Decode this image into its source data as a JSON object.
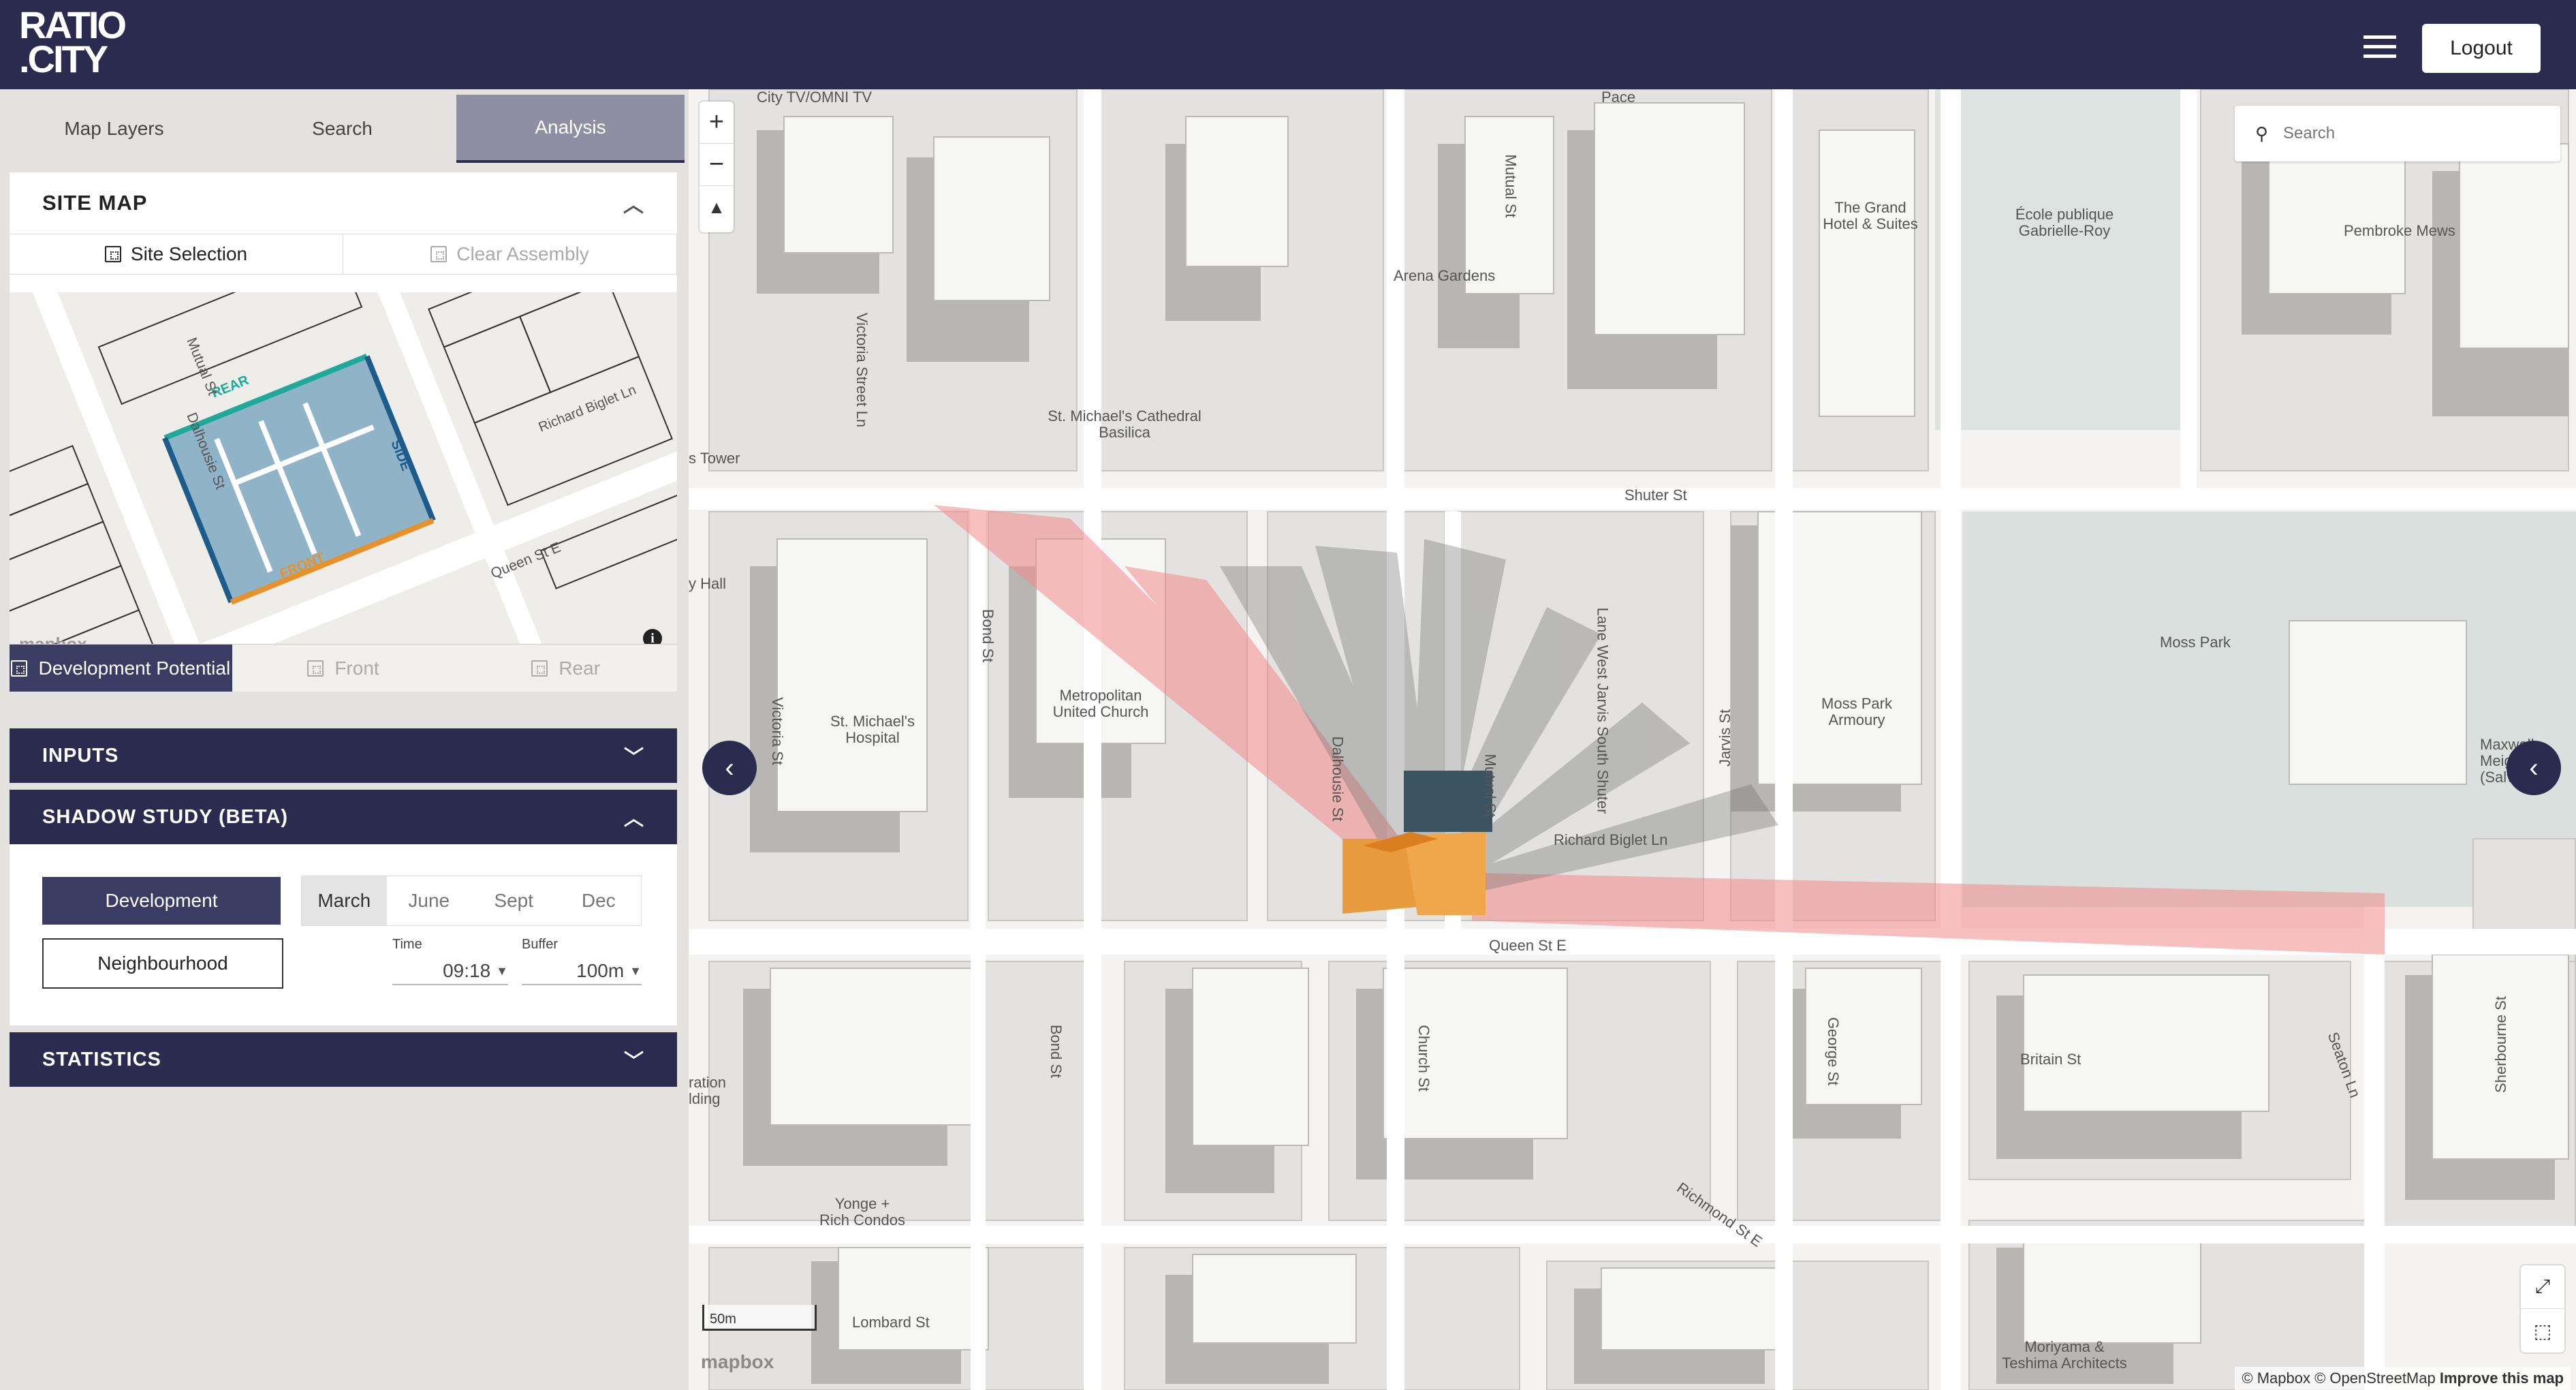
{
  "header": {
    "logo_line1": "RATIO",
    "logo_line2": ".CITY",
    "logout_label": "Logout",
    "menu_icon": "hamburger-menu-icon"
  },
  "sidebar": {
    "tabs": [
      {
        "label": "Map Layers",
        "active": false
      },
      {
        "label": "Search",
        "active": false
      },
      {
        "label": "Analysis",
        "active": true
      }
    ],
    "site_map": {
      "title": "SITE MAP",
      "site_selection_label": "Site Selection",
      "clear_assembly_label": "Clear Assembly",
      "mini_labels": {
        "dalhousie": "Dalhousie St",
        "mutual": "Mutual St",
        "richard": "Richard Biglet Ln",
        "queen": "Queen St E",
        "rear": "REAR",
        "side": "SIDE",
        "front": "FRONT"
      },
      "mapbox_logo": "mapbox",
      "info_icon": "i"
    },
    "dev_tabs": [
      {
        "label": "Development Potential",
        "active": true
      },
      {
        "label": "Front",
        "active": false
      },
      {
        "label": "Rear",
        "active": false
      }
    ],
    "inputs_title": "INPUTS",
    "shadow": {
      "title": "SHADOW STUDY (BETA)",
      "development_label": "Development",
      "neighbourhood_label": "Neighbourhood",
      "months": [
        {
          "label": "March",
          "active": true
        },
        {
          "label": "June",
          "active": false
        },
        {
          "label": "Sept",
          "active": false
        },
        {
          "label": "Dec",
          "active": false
        }
      ],
      "time_label": "Time",
      "time_value": "09:18",
      "buffer_label": "Buffer",
      "buffer_value": "100m"
    },
    "statistics_title": "STATISTICS"
  },
  "map": {
    "search_placeholder": "Search",
    "zoom_in": "+",
    "zoom_out": "−",
    "compass": "▲",
    "scale_label": "50m",
    "mapbox_logo": "mapbox",
    "attribution_1": "© Mapbox © OpenStreetMap ",
    "attribution_2": "Improve this map",
    "labels": {
      "city_tv": "City TV/OMNI TV",
      "pace": "Pace",
      "mutual_top": "Mutual St",
      "grand_hotel": "The Grand Hotel & Suites",
      "ecole": "École publique Gabrielle-Roy",
      "pembroke": "Pembroke Mews",
      "arena": "Arena Gardens",
      "victoria_ln": "Victoria Street Ln",
      "cathedral": "St. Michael's Cathedral Basilica",
      "tower": "s Tower",
      "shuter": "Shuter St",
      "hall": "y Hall",
      "bond": "Bond St",
      "metropolitan": "Metropolitan United Church",
      "victoria": "Victoria St",
      "hospital": "St. Michael's Hospital",
      "dalhousie": "Dalhousie St",
      "mutual_mid": "Mutual St",
      "lane": "Lane West Jarvis South Shuter",
      "jarvis": "Jarvis St",
      "moss_park": "Moss Park",
      "armoury": "Moss Park Armoury",
      "maxwell": "Maxwell Meighen (Salvation",
      "richard": "Richard Biglet Ln",
      "queen": "Queen St E",
      "sherbourne": "Sherbourne St",
      "ration": "ration lding",
      "bond_low": "Bond St",
      "church": "Church St",
      "george": "George St",
      "britain": "Britain St",
      "seaton": "Seaton Ln",
      "richmond": "Richmond St E",
      "yonge": "Yonge + Rich Condos",
      "lombard": "Lombard St",
      "moriyama": "Moriyama & Teshima Architects"
    }
  },
  "colors": {
    "navy": "#2a2b4e",
    "shadow_red": "#f08a8a",
    "building_orange": "#e8912a",
    "site_teal": "#1fa99a",
    "site_blue": "#1d5c8a"
  }
}
